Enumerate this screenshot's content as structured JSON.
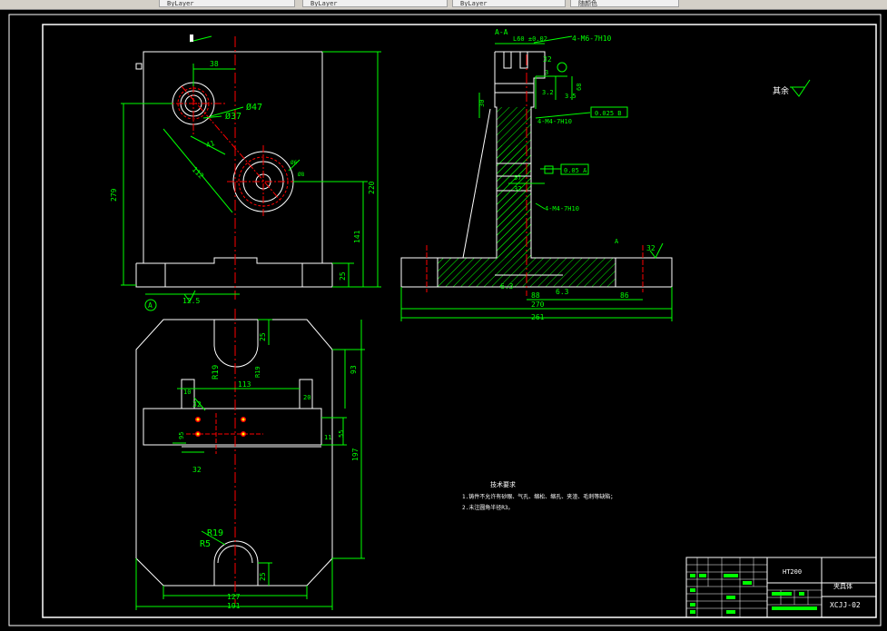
{
  "toolbar": {
    "tabs": [
      {
        "label": "ByLayer"
      },
      {
        "label": "ByLayer"
      },
      {
        "label": "ByLayer"
      },
      {
        "label": "随颜色"
      }
    ]
  },
  "colors": {
    "background": "#000000",
    "outline": "#ffffff",
    "dimension": "#00ff00",
    "centerline": "#ff0000",
    "hatch": "#00ff00",
    "accent": "#ffff00"
  },
  "front_view": {
    "dims": {
      "d38": "38",
      "phi47": "Ø47",
      "phi37": "Ø37",
      "d112": "112",
      "d41": "41",
      "d279": "279",
      "d220": "220",
      "d141": "141",
      "d25": "25",
      "d125": "12.5",
      "phi6": "Ø6",
      "phi8": "Ø8"
    },
    "datum_label": "A"
  },
  "section_view": {
    "title": "A-A",
    "dims": {
      "l60": "L60 ±0.02",
      "d32a": "32",
      "d3": "3",
      "thread1": "4-M6-7H10",
      "d32b": "3.2",
      "d35": "3.5",
      "d68": "68",
      "d30": "30",
      "thread2": "4-M4-7H10",
      "tol1": "0.025 B",
      "d57": "57",
      "tol2": "0.05 A",
      "d32c": "32",
      "thread3": "4-M4-7H10",
      "rough1": "32",
      "d63a": "6.3",
      "d63b": "6.3",
      "d88": "88",
      "d86": "86",
      "d270": "270",
      "d261": "261",
      "datum": "A"
    }
  },
  "top_view": {
    "dims": {
      "d25a": "25",
      "r19a": "R19",
      "d93": "93",
      "d113": "113",
      "d10": "10",
      "d20": "20",
      "d32a": "32",
      "d95": "95",
      "d32b": "32",
      "d11": "11",
      "d55": "55",
      "d197": "197",
      "r19b": "R19",
      "r5": "R5",
      "d25b": "25",
      "d127": "127",
      "d191": "191"
    }
  },
  "surface_note": {
    "label": "其余",
    "symbol": "✓"
  },
  "tech_requirements": {
    "title": "技术要求",
    "lines": [
      "1.铸件不允许有砂眼、气孔、缩松、缩孔、夹渣、毛刺等缺陷；",
      "2.未注圆角半径R3。"
    ]
  },
  "title_block": {
    "material": "HT200",
    "part_name": "夹具体",
    "drawing_no": "XCJJ-02"
  }
}
